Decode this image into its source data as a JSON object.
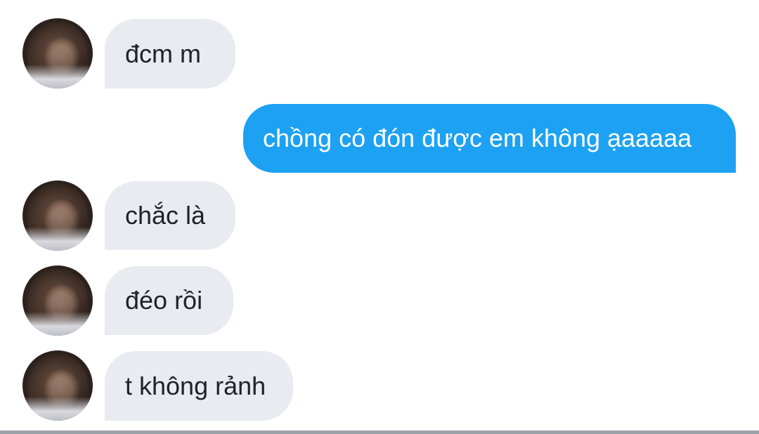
{
  "conversation": {
    "messages": [
      {
        "sender": "them",
        "text": "đcm m"
      },
      {
        "sender": "me",
        "text": "chồng có đón được em không ạaaaaa"
      },
      {
        "sender": "them",
        "text": "chắc là"
      },
      {
        "sender": "them",
        "text": "đéo rồi"
      },
      {
        "sender": "them",
        "text": "t không rảnh"
      }
    ]
  },
  "colors": {
    "received_bubble": "#e8ebef",
    "sent_bubble": "#1da1f2",
    "received_text": "#1f2326",
    "sent_text": "#ffffff"
  }
}
